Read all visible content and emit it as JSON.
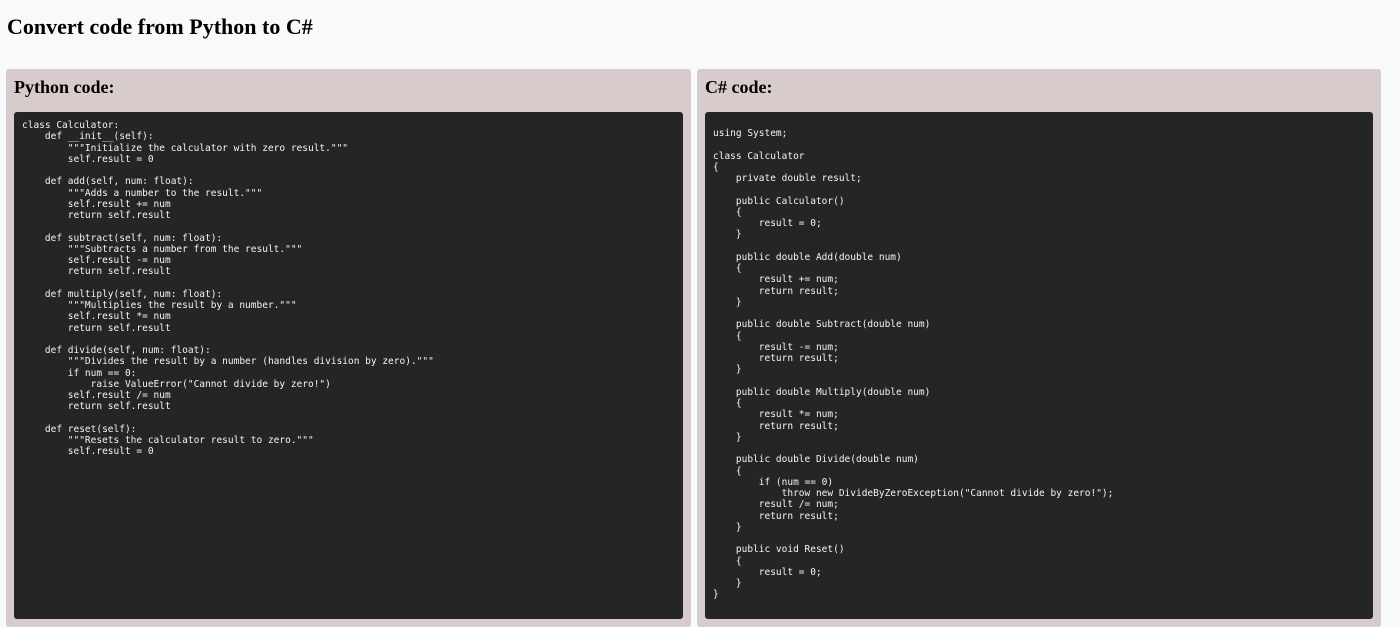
{
  "page": {
    "title": "Convert code from Python to C#"
  },
  "source_panel": {
    "heading": "Python code:",
    "code": "class Calculator:\n    def __init__(self):\n        \"\"\"Initialize the calculator with zero result.\"\"\"\n        self.result = 0\n\n    def add(self, num: float):\n        \"\"\"Adds a number to the result.\"\"\"\n        self.result += num\n        return self.result\n\n    def subtract(self, num: float):\n        \"\"\"Subtracts a number from the result.\"\"\"\n        self.result -= num\n        return self.result\n\n    def multiply(self, num: float):\n        \"\"\"Multiplies the result by a number.\"\"\"\n        self.result *= num\n        return self.result\n\n    def divide(self, num: float):\n        \"\"\"Divides the result by a number (handles division by zero).\"\"\"\n        if num == 0:\n            raise ValueError(\"Cannot divide by zero!\")\n        self.result /= num\n        return self.result\n\n    def reset(self):\n        \"\"\"Resets the calculator result to zero.\"\"\"\n        self.result = 0"
  },
  "output_panel": {
    "heading": "C# code:",
    "code": "using System;\n\nclass Calculator\n{\n    private double result;\n\n    public Calculator()\n    {\n        result = 0;\n    }\n\n    public double Add(double num)\n    {\n        result += num;\n        return result;\n    }\n\n    public double Subtract(double num)\n    {\n        result -= num;\n        return result;\n    }\n\n    public double Multiply(double num)\n    {\n        result *= num;\n        return result;\n    }\n\n    public double Divide(double num)\n    {\n        if (num == 0)\n            throw new DivideByZeroException(\"Cannot divide by zero!\");\n        result /= num;\n        return result;\n    }\n\n    public void Reset()\n    {\n        result = 0;\n    }\n}"
  },
  "colors": {
    "page_background": "#f8f9fb",
    "panel_background": "#d8cbcc",
    "code_background": "#252525",
    "code_text": "#f4f4f4"
  }
}
